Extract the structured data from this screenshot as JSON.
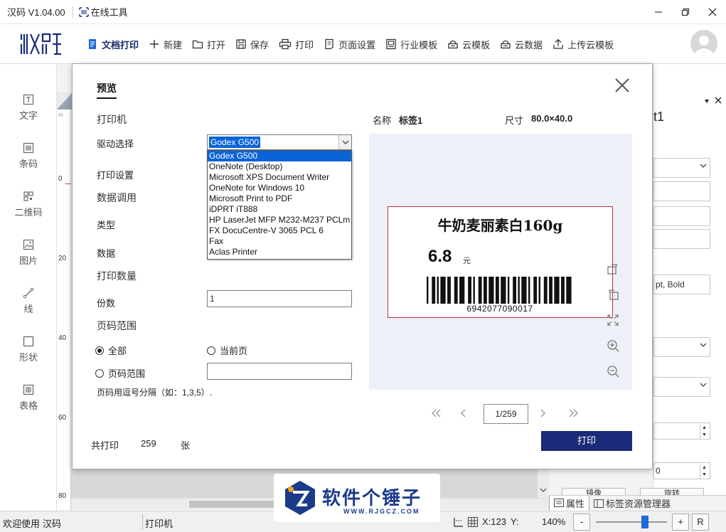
{
  "window": {
    "title": "汉码 V1.04.00",
    "online_tools": "在线工具"
  },
  "toolbar": {
    "items": [
      {
        "label": "文档打印",
        "icon": "document-print-icon"
      },
      {
        "label": "新建",
        "icon": "plus-icon"
      },
      {
        "label": "打开",
        "icon": "folder-icon"
      },
      {
        "label": "保存",
        "icon": "save-icon"
      },
      {
        "label": "打印",
        "icon": "printer-icon"
      },
      {
        "label": "页面设置",
        "icon": "page-setup-icon"
      },
      {
        "label": "行业模板",
        "icon": "template-icon"
      },
      {
        "label": "云模板",
        "icon": "cloud-template-icon"
      },
      {
        "label": "云数据",
        "icon": "cloud-data-icon"
      },
      {
        "label": "上传云模板",
        "icon": "upload-icon"
      }
    ]
  },
  "sidebar": {
    "items": [
      {
        "label": "文字",
        "icon": "text-icon"
      },
      {
        "label": "条码",
        "icon": "barcode-icon"
      },
      {
        "label": "二维码",
        "icon": "qrcode-icon"
      },
      {
        "label": "图片",
        "icon": "image-icon"
      },
      {
        "label": "线",
        "icon": "line-icon"
      },
      {
        "label": "形状",
        "icon": "shape-icon"
      },
      {
        "label": "表格",
        "icon": "table-icon"
      }
    ]
  },
  "ruler": {
    "marks": [
      "m",
      "0",
      "20",
      "40",
      "60",
      "80"
    ]
  },
  "right_panel": {
    "title_fragment": "t1",
    "font_value": "pt, Bold",
    "num_value": "0",
    "btn1": "镜像",
    "btn2": "旋转",
    "tabs": [
      "属性",
      "标签资源管理器"
    ]
  },
  "dialog": {
    "title": "预览",
    "sections": {
      "printer": "打印机",
      "driver_label": "驱动选择",
      "print_settings": "打印设置",
      "data_call": "数据调用",
      "type_label": "类型",
      "data_label": "数据",
      "print_qty": "打印数量",
      "copies_label": "份数",
      "page_range": "页码范围"
    },
    "driver": {
      "selected": "Godex G500",
      "options": [
        "Godex G500",
        "OneNote (Desktop)",
        "Microsoft XPS Document Writer",
        "OneNote for Windows 10",
        "Microsoft Print to PDF",
        "iDPRT iT888",
        "HP LaserJet MFP M232-M237 PCLm",
        "FX DocuCentre-V 3065 PCL 6",
        "Fax",
        "Aclas Printer"
      ]
    },
    "copies_value": "1",
    "radio_all": "全部",
    "radio_current": "当前页",
    "radio_range": "页码范围",
    "range_value": "",
    "range_hint": "页码用逗号分隔（如：1,3,5）.",
    "total_prefix": "共打印",
    "total_count": "259",
    "total_suffix": "张",
    "name_label": "名称",
    "name_value": "标签1",
    "size_label": "尺寸",
    "size_value": "80.0×40.0",
    "label": {
      "product": "牛奶麦丽素白160g",
      "price": "6.8",
      "unit": "元",
      "barcode": "6942077090017"
    },
    "page_indicator": "1/259",
    "print_button": "打印"
  },
  "statusbar": {
    "welcome": "欢迎使用",
    "app": "汉码",
    "printer": "打印机",
    "coord_x": "X:123",
    "coord_y": "Y:",
    "zoom": "140%",
    "zoom_out": "-",
    "zoom_in": "+",
    "reset": "R"
  },
  "watermark": {
    "text": "软件个锤子",
    "url": "WWW.RJGCZ.COM"
  },
  "colors": {
    "brand": "#1b2b7a",
    "selection": "#0a64d8",
    "label_border": "#c0303a"
  }
}
